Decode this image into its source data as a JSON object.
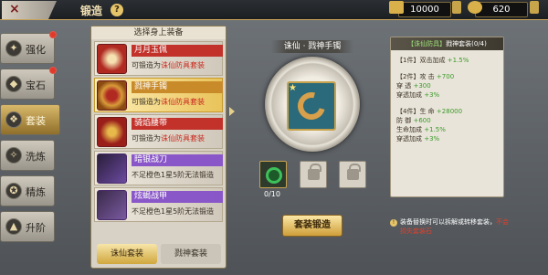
{
  "header": {
    "title": "锻造",
    "help": "?",
    "currency_gold": "10000",
    "currency_gem": "620",
    "close_label": "×"
  },
  "nav": {
    "items": [
      {
        "label": "强化",
        "badge": true
      },
      {
        "label": "宝石",
        "badge": true
      },
      {
        "label": "套装",
        "badge": false
      },
      {
        "label": "洗炼",
        "badge": false
      },
      {
        "label": "精炼",
        "badge": false
      },
      {
        "label": "升阶",
        "badge": false
      }
    ],
    "active_index": 2
  },
  "equip_list": {
    "header": "选择身上装备",
    "items": [
      {
        "name": "月月玉佩",
        "desc_prefix": "可锻造为",
        "desc_red": "诛仙防具套装",
        "color": "#c2322a"
      },
      {
        "name": "戮神手镯",
        "desc_prefix": "可锻造为",
        "desc_red": "诛仙防具套装",
        "color": "#c98b2a"
      },
      {
        "name": "骑焰腰带",
        "desc_prefix": "可锻造为",
        "desc_red": "诛仙防具套装",
        "color": "#c2322a"
      },
      {
        "name": "暗银战刀",
        "desc_prefix": "不足橙色1星5阶无法锻造",
        "desc_red": "",
        "color": "#8a57c9"
      },
      {
        "name": "炫蝎战甲",
        "desc_prefix": "不足橙色1星5阶无法锻造",
        "desc_red": "",
        "color": "#8a57c9"
      }
    ],
    "tabs": [
      "诛仙套装",
      "戮神套装"
    ]
  },
  "center": {
    "title": "诛仙 · 戮神手镯",
    "material_count": "0/10",
    "forge_button": "套装锻造"
  },
  "info": {
    "header_prefix": "【诛仙防具】",
    "header_name": "戮神套装(0/4)",
    "bonuses": [
      {
        "label": "【1件】双击加成",
        "value": "+1.5%"
      },
      {
        "label": "【2件】攻  击",
        "value": "+700"
      },
      {
        "label": "         穿  透",
        "value": "+300"
      },
      {
        "label": "         穿透加成",
        "value": "+3%"
      },
      {
        "label": "【4件】生  命",
        "value": "+28000"
      },
      {
        "label": "         防  御",
        "value": "+600"
      },
      {
        "label": "         生命加成",
        "value": "+1.5%"
      },
      {
        "label": "         穿透加成",
        "value": "+3%"
      }
    ]
  },
  "hint": {
    "text": "装备替换时可以拆解或转移套装，",
    "red": "不会损失套装石"
  }
}
